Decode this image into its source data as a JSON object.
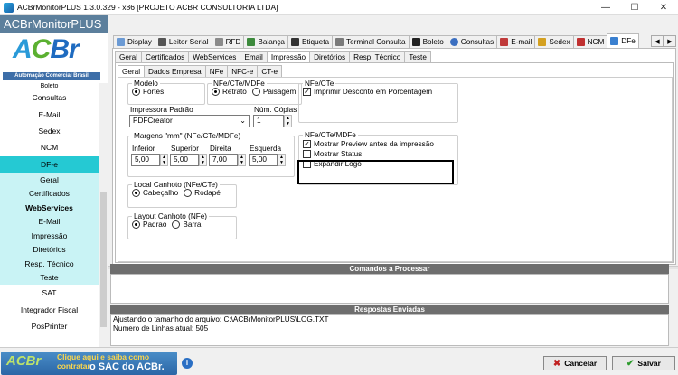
{
  "window": {
    "title": "ACBrMonitorPLUS 1.3.0.329 - x86  [PROJETO ACBR CONSULTORIA LTDA]"
  },
  "brand": {
    "app_name": "ACBrMonitorPLUS",
    "logo_a": "A",
    "logo_c": "C",
    "logo_br": "Br",
    "tagline": "Automação Comercial Brasil"
  },
  "sidebar": {
    "items": [
      {
        "label": "Boleto"
      },
      {
        "label": "Consultas"
      },
      {
        "label": "E-Mail"
      },
      {
        "label": "Sedex"
      },
      {
        "label": "NCM"
      },
      {
        "label": "DF-e"
      },
      {
        "label": "Geral"
      },
      {
        "label": "Certificados"
      },
      {
        "label": "WebServices"
      },
      {
        "label": "E-Mail"
      },
      {
        "label": "Impressão"
      },
      {
        "label": "Diretórios"
      },
      {
        "label": "Resp. Técnico"
      },
      {
        "label": "Teste"
      },
      {
        "label": "SAT"
      },
      {
        "label": "Integrador Fiscal"
      },
      {
        "label": "PosPrinter"
      }
    ]
  },
  "top_tabs": [
    {
      "label": "Display",
      "color": "#6b9ad4"
    },
    {
      "label": "Leitor Serial",
      "color": "#555555"
    },
    {
      "label": "RFD",
      "color": "#8a8a8a"
    },
    {
      "label": "Balança",
      "color": "#3c8a3c"
    },
    {
      "label": "Etiqueta",
      "color": "#333333"
    },
    {
      "label": "Terminal Consulta",
      "color": "#7a7a7a"
    },
    {
      "label": "Boleto",
      "color": "#222222"
    },
    {
      "label": "Consultas",
      "color": "#3a6ec0"
    },
    {
      "label": "E-mail",
      "color": "#c03a3a"
    },
    {
      "label": "Sedex",
      "color": "#d4a020"
    },
    {
      "label": "NCM",
      "color": "#c03030"
    },
    {
      "label": "DFe",
      "color": "#3a80d0"
    }
  ],
  "tab_arrows": {
    "left": "◀",
    "right": "▶"
  },
  "dfe_tabs": [
    "Geral",
    "Certificados",
    "WebServices",
    "Email",
    "Impressão",
    "Diretórios",
    "Resp. Técnico",
    "Teste"
  ],
  "print_tabs": [
    "Geral",
    "Dados Empresa",
    "NFe",
    "NFC-e",
    "CT-e"
  ],
  "modelo": {
    "title": "Modelo",
    "option": "Fortes"
  },
  "orientacao": {
    "title": "NFe/CTe/MDFe",
    "opt1": "Retrato",
    "opt2": "Paisagem"
  },
  "impressora": {
    "label": "Impressora Padrão",
    "value": "PDFCreator",
    "copies_label": "Núm. Cópias",
    "copies_value": "1"
  },
  "margens": {
    "title": "Margens \"mm\" (NFe/CTe/MDFe)",
    "inferior_label": "Inferior",
    "inferior": "5,00",
    "superior_label": "Superior",
    "superior": "5,00",
    "direita_label": "Direita",
    "direita": "7,00",
    "esquerda_label": "Esquerda",
    "esquerda": "5,00"
  },
  "canhoto": {
    "title": "Local Canhoto (NFe/CTe)",
    "opt1": "Cabeçalho",
    "opt2": "Rodapé"
  },
  "layout_canhoto": {
    "title": "Layout Canhoto (NFe)",
    "opt1": "Padrao",
    "opt2": "Barra"
  },
  "nfce_cte": {
    "title": "NFe/CTe",
    "check": "Imprimir Desconto em Porcentagem"
  },
  "nfe_cte_mdfe": {
    "title": "NFe/CTe/MDFe",
    "preview": "Mostrar Preview antes da impressão",
    "status": "Mostrar Status",
    "logo": "Expandir Logo"
  },
  "comandos": {
    "title": "Comandos a Processar"
  },
  "respostas": {
    "title": "Respostas Enviadas",
    "lines": [
      "Ajustando o tamanho do arquivo: C:\\ACBrMonitorPLUS\\LOG.TXT",
      "Numero de Linhas atual: 505"
    ]
  },
  "bottom": {
    "banner_logo": "ACBr",
    "banner_line1": "Clique aqui e saiba como contratar",
    "banner_line2": "o SAC do ACBr.",
    "help": "i",
    "cancel": "Cancelar",
    "save": "Salvar"
  }
}
